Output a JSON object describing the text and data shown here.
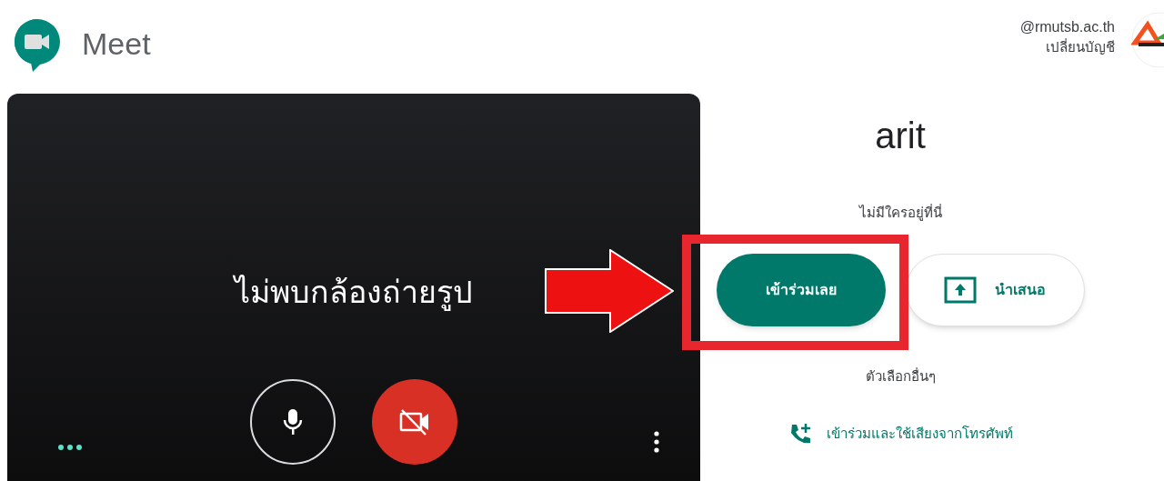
{
  "header": {
    "app_name": "Meet",
    "account_email": "@rmutsb.ac.th",
    "switch_account": "เปลี่ยนบัญชี"
  },
  "preview": {
    "message": "ไม่พบกล้องถ่ายรูป",
    "mic_on": true,
    "camera_on": false
  },
  "meeting": {
    "name": "arit",
    "status": "ไม่มีใครอยู่ที่นี่",
    "join_button": "เข้าร่วมเลย",
    "present_button": "นำเสนอ",
    "other_options": "ตัวเลือกอื่นๆ",
    "phone_link": "เข้าร่วมและใช้เสียงจากโทรศัพท์"
  },
  "annotation": {
    "highlight": true
  }
}
